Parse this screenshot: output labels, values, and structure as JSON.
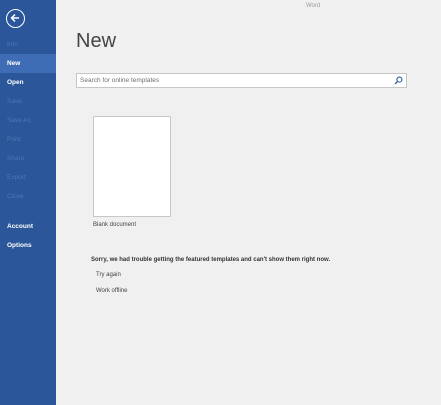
{
  "app": {
    "name": "Word"
  },
  "sidebar": {
    "back_icon": "back-arrow-icon",
    "items": [
      {
        "label": "Info",
        "state": "disabled"
      },
      {
        "label": "New",
        "state": "active"
      },
      {
        "label": "Open",
        "state": "normal"
      },
      {
        "label": "Save",
        "state": "disabled"
      },
      {
        "label": "Save As",
        "state": "disabled"
      },
      {
        "label": "Print",
        "state": "disabled"
      },
      {
        "label": "Share",
        "state": "disabled"
      },
      {
        "label": "Export",
        "state": "disabled"
      },
      {
        "label": "Close",
        "state": "disabled"
      },
      {
        "label": "Account",
        "state": "normal"
      },
      {
        "label": "Options",
        "state": "normal"
      }
    ]
  },
  "main": {
    "title": "New",
    "search": {
      "placeholder": "Search for online templates",
      "value": "",
      "icon": "search-icon"
    },
    "templates": [
      {
        "label": "Blank document"
      }
    ],
    "error_message": "Sorry, we had trouble getting the featured templates and can't show them right now.",
    "actions": {
      "try_again": "Try again",
      "work_offline": "Work offline"
    }
  },
  "colors": {
    "sidebar_bg": "#2b579a",
    "sidebar_active": "#3e6db5",
    "sidebar_disabled_text": "#4d76b2",
    "page_bg": "#f0f0f0"
  }
}
